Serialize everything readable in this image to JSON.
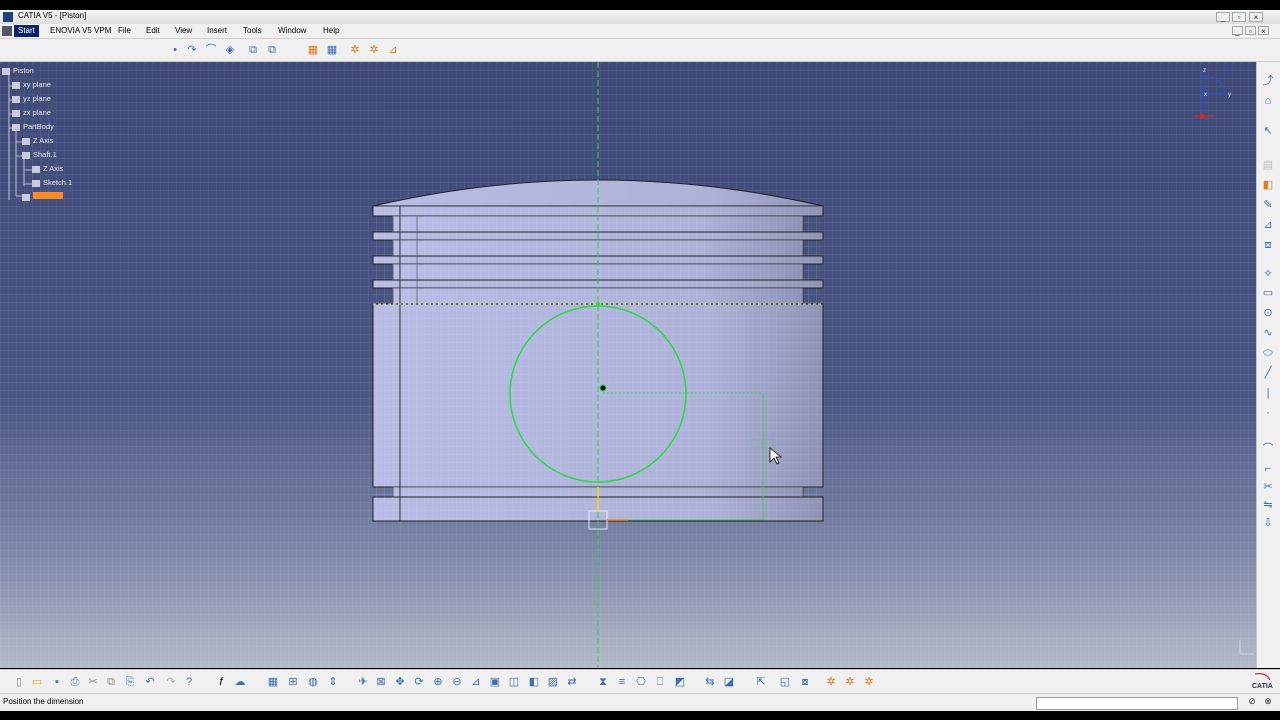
{
  "window": {
    "title": "CATIA V5 - [Piston]",
    "controls": [
      "minimize-icon",
      "restore-icon",
      "close-icon"
    ]
  },
  "menubar": {
    "items": [
      "Start",
      "ENOVIA V5 VPM",
      "File",
      "Edit",
      "View",
      "Insert",
      "Tools",
      "Window",
      "Help"
    ]
  },
  "tree": {
    "items": [
      {
        "label": "Piston",
        "icon": "part-icon"
      },
      {
        "label": "xy plane",
        "icon": "plane-icon"
      },
      {
        "label": "yz plane",
        "icon": "plane-icon"
      },
      {
        "label": "zx plane",
        "icon": "plane-icon"
      },
      {
        "label": "PartBody",
        "icon": "body-icon"
      },
      {
        "label": "Z Axis",
        "icon": "axis-icon"
      },
      {
        "label": "Shaft.1",
        "icon": "shaft-icon"
      },
      {
        "label": "Z Axis",
        "icon": "axis-icon"
      },
      {
        "label": "Sketch.1",
        "icon": "sketch-icon"
      },
      {
        "label": "",
        "icon": "sketch-icon",
        "highlighted": true
      }
    ]
  },
  "compass": {
    "axes": [
      "z",
      "x",
      "y"
    ]
  },
  "status": {
    "message": "Position the dimension"
  },
  "brand": {
    "logo_text": "CATIA"
  },
  "colors": {
    "viewport_top": "#3f4a79",
    "viewport_bottom": "#b5bac9",
    "sketch_green": "#2fd84a",
    "highlight_orange": "#ff8a2a",
    "piston_fill": "#b8bde0"
  }
}
